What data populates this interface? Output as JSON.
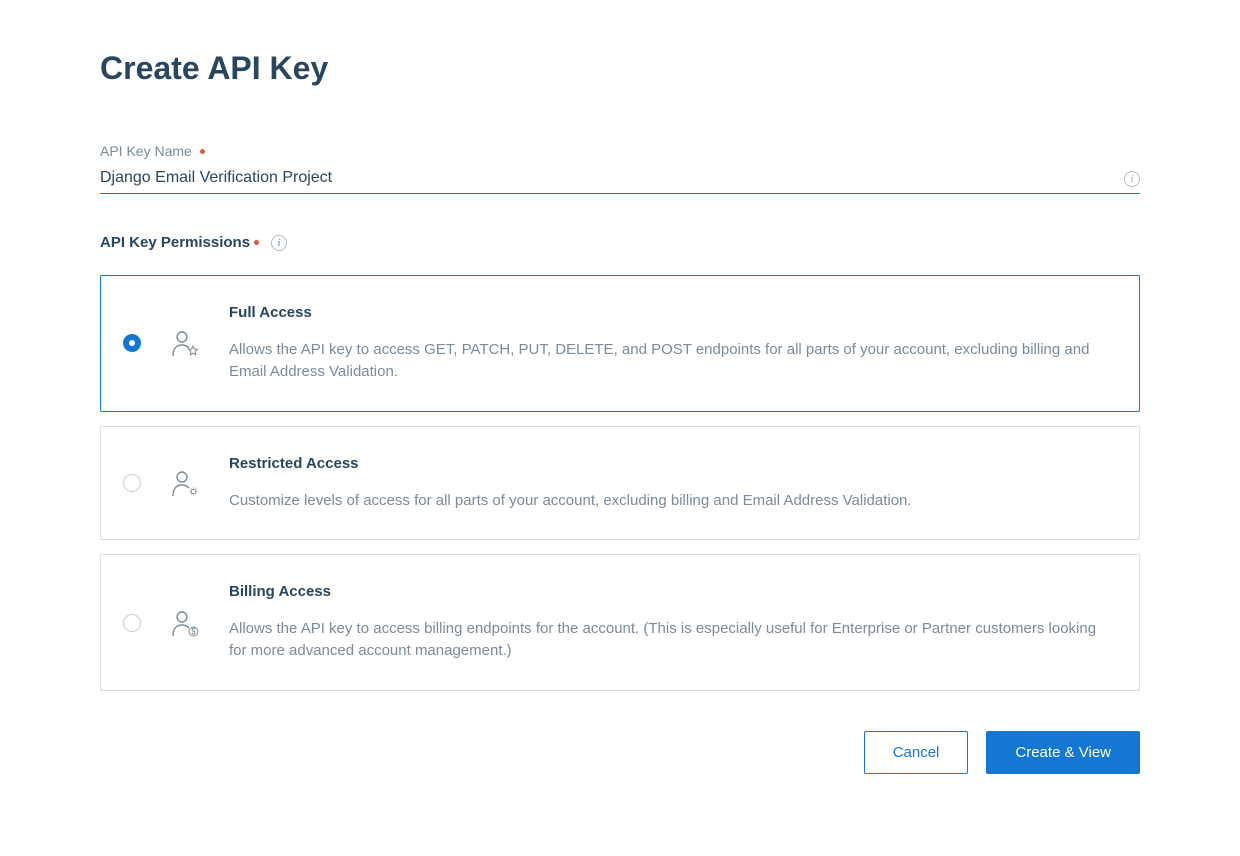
{
  "page_title": "Create API Key",
  "name_field": {
    "label": "API Key Name",
    "value": "Django Email Verification Project"
  },
  "permissions": {
    "label": "API Key Permissions",
    "options": [
      {
        "title": "Full Access",
        "desc": "Allows the API key to access GET, PATCH, PUT, DELETE, and POST endpoints for all parts of your account, excluding billing and Email Address Validation.",
        "selected": true
      },
      {
        "title": "Restricted Access",
        "desc": "Customize levels of access for all parts of your account, excluding billing and Email Address Validation.",
        "selected": false
      },
      {
        "title": "Billing Access",
        "desc": "Allows the API key to access billing endpoints for the account. (This is especially useful for Enterprise or Partner customers looking for more advanced account management.)",
        "selected": false
      }
    ]
  },
  "actions": {
    "cancel": "Cancel",
    "submit": "Create & View"
  }
}
